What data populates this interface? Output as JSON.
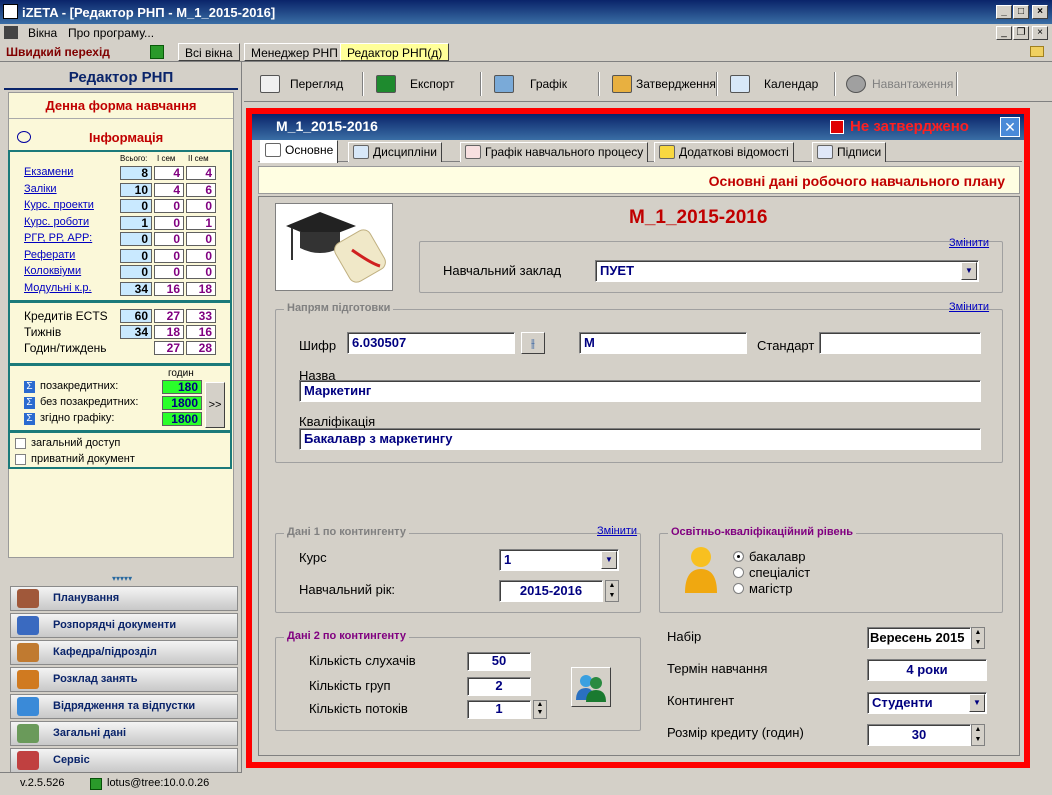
{
  "window": {
    "title": "iZETA - [Редактор РНП - М_1_2015-2016]"
  },
  "menu": {
    "items": [
      "Вікна",
      "Про програму..."
    ]
  },
  "quickbar": {
    "label": "Швидкий перехід",
    "tabs": [
      "Всі вікна",
      "Менеджер РНП",
      "Редактор РНП(д)"
    ]
  },
  "left": {
    "title": "Редактор РНП",
    "form": "Денна форма навчання",
    "info_title": "Інформація",
    "headers": {
      "total": "Всього:",
      "sem1": "I сем",
      "sem2": "II сем"
    },
    "rows": [
      {
        "label": "Екзамени",
        "total": "8",
        "s1": "4",
        "s2": "4"
      },
      {
        "label": "Заліки",
        "total": "10",
        "s1": "4",
        "s2": "6"
      },
      {
        "label": "Курс. проекти",
        "total": "0",
        "s1": "0",
        "s2": "0"
      },
      {
        "label": "Курс. роботи",
        "total": "1",
        "s1": "0",
        "s2": "1"
      },
      {
        "label": "РГР, РР, АРР:",
        "total": "0",
        "s1": "0",
        "s2": "0"
      },
      {
        "label": "Реферати",
        "total": "0",
        "s1": "0",
        "s2": "0"
      },
      {
        "label": "Колоквіуми",
        "total": "0",
        "s1": "0",
        "s2": "0"
      },
      {
        "label": "Модульні к.р.",
        "total": "34",
        "s1": "16",
        "s2": "18"
      }
    ],
    "credits": [
      {
        "label": "Кредитів ECTS",
        "total": "60",
        "s1": "27",
        "s2": "33"
      },
      {
        "label": "Тижнів",
        "total": "34",
        "s1": "18",
        "s2": "16"
      },
      {
        "label": "Годин/тиждень",
        "total": "",
        "s1": "27",
        "s2": "28"
      }
    ],
    "hours_header": "годин",
    "hours": [
      {
        "label": "позакредитних:",
        "value": "180"
      },
      {
        "label": "без позакредитних:",
        "value": "1800"
      },
      {
        "label": "згідно графіку:",
        "value": "1800"
      }
    ],
    "expand_label": ">>",
    "checks": [
      "загальний доступ",
      "приватний документ"
    ],
    "nav": [
      "Планування",
      "Розпорядчі документи",
      "Кафедра/підрозділ",
      "Розклад занять",
      "Відрядження та відпустки",
      "Загальні дані",
      "Сервіс"
    ],
    "collapse_glyph": "▾▾▾▾▾"
  },
  "toolbar": {
    "items": [
      "Перегляд",
      "Експорт",
      "Графік",
      "Затвердження",
      "Календар",
      "Навантаження"
    ]
  },
  "doc": {
    "title": "М_1_2015-2016",
    "status": "Не затверджено",
    "tabs": [
      "Основне",
      "Дисципліни",
      "Графік навчального процесу",
      "Додаткові відомості",
      "Підписи"
    ],
    "banner": "Основні дані робочого навчального плану",
    "heading": "М_1_2015-2016",
    "change": "Змінити",
    "institution_label": "Навчальний заклад",
    "institution": "ПУЕТ",
    "direction_group": "Напрям підготовки",
    "code_label": "Шифр",
    "code": "6.030507",
    "code2": "М",
    "standard_label": "Стандарт",
    "standard": "",
    "name_label": "Назва",
    "name": "Маркетинг",
    "qual_label": "Кваліфікація",
    "qual": "Бакалавр з маркетингу",
    "cont1_group": "Дані 1 по контингенту",
    "course_label": "Курс",
    "course": "1",
    "year_label": "Навчальний рік:",
    "year": "2015-2016",
    "level_group": "Освітньо-кваліфікаційний рівень",
    "levels": [
      "бакалавр",
      "спеціаліст",
      "магістр"
    ],
    "cont2_group": "Дані 2 по контингенту",
    "students_label": "Кількість слухачів",
    "students": "50",
    "groups_label": "Кількість груп",
    "groups": "2",
    "streams_label": "Кількість потоків",
    "streams": "1",
    "intake_label": "Набір",
    "intake": "Вересень 2015",
    "term_label": "Термін навчання",
    "term": "4 роки",
    "contingent_label": "Контингент",
    "contingent": "Студенти",
    "credit_label": "Розмір кредиту (годин)",
    "credit": "30"
  },
  "status": {
    "version": "v.2.5.526",
    "user": "lotus@tree:10.0.0.26"
  }
}
